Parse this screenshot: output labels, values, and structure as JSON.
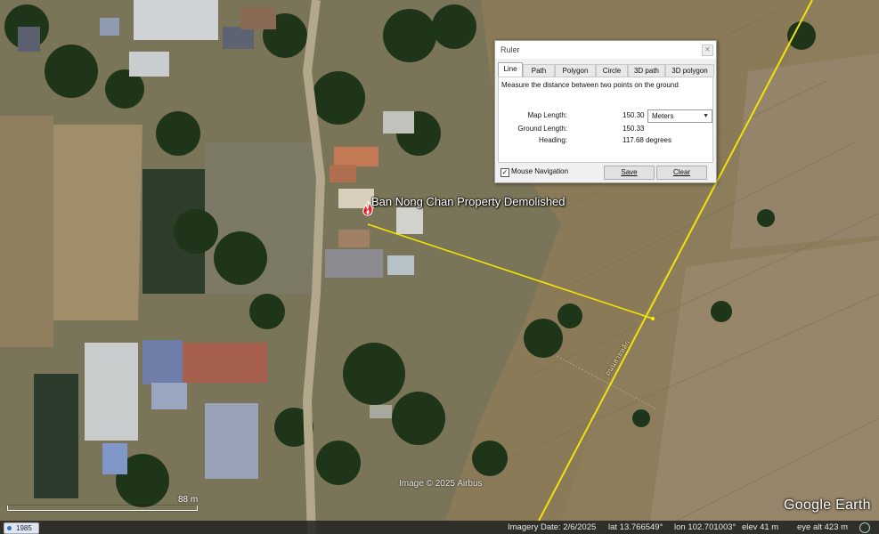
{
  "placemark": {
    "label": "Ban Nong Chan Property Demolished",
    "icon": "fire-icon"
  },
  "map": {
    "image_credit": "Image © 2025 Airbus",
    "scale_label": "88 m",
    "road_label": "ถนนสายหลัก",
    "logo": "Google Earth"
  },
  "status_bar": {
    "historical_year": "1985",
    "imagery_date": "Imagery Date: 2/6/2025",
    "lat": "lat   13.766549°",
    "lon": "lon  102.701003°",
    "elev": "elev     41 m",
    "eye_alt": "eye alt    423 m"
  },
  "ruler": {
    "title": "Ruler",
    "tabs": [
      "Line",
      "Path",
      "Polygon",
      "Circle",
      "3D path",
      "3D polygon"
    ],
    "active_tab": "Line",
    "description": "Measure the distance between two points on the ground",
    "map_length_label": "Map Length:",
    "map_length_value": "150.30",
    "unit": "Meters",
    "ground_length_label": "Ground Length:",
    "ground_length_value": "150.33",
    "heading_label": "Heading:",
    "heading_value": "117.68 degrees",
    "mouse_navigation_label": "Mouse Navigation",
    "mouse_navigation_checked": true,
    "save_label": "Save",
    "clear_label": "Clear"
  },
  "colors": {
    "measure_line": "#f2e600",
    "road_line": "#f0e20a",
    "fields": "#9a8a68",
    "vegetation": "#1f3a1c"
  }
}
